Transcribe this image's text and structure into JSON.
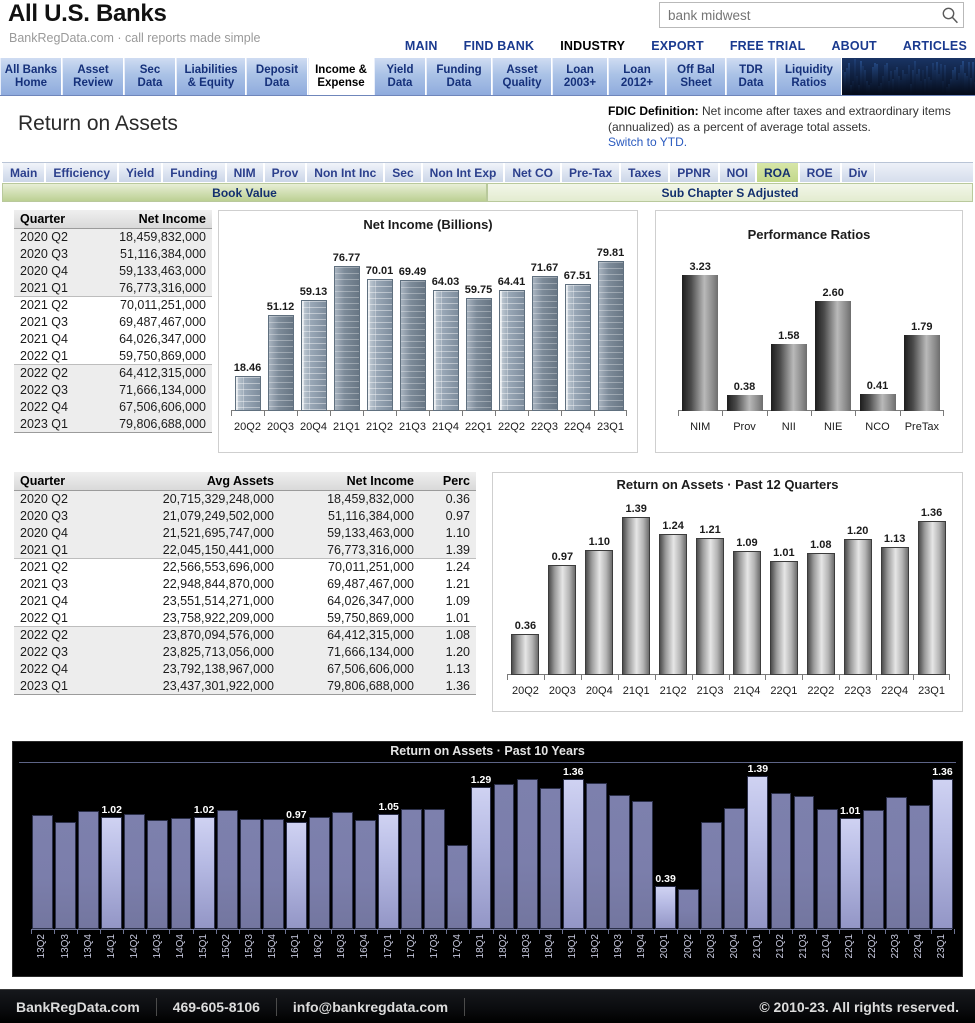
{
  "header": {
    "title": "All U.S. Banks",
    "subtitle": "BankRegData.com · call reports made simple",
    "search": {
      "value": "bank midwest",
      "placeholder": "bank midwest",
      "icon": "search-icon"
    },
    "nav": [
      "MAIN",
      "FIND BANK",
      "INDUSTRY",
      "EXPORT",
      "FREE TRIAL",
      "ABOUT",
      "ARTICLES"
    ],
    "nav_active": "INDUSTRY"
  },
  "tabs": {
    "items": [
      {
        "l1": "All Banks",
        "l2": "Home"
      },
      {
        "l1": "Asset",
        "l2": "Review"
      },
      {
        "l1": "Sec",
        "l2": "Data"
      },
      {
        "l1": "Liabilities",
        "l2": "& Equity"
      },
      {
        "l1": "Deposit",
        "l2": "Data"
      },
      {
        "l1": "Income &",
        "l2": "Expense"
      },
      {
        "l1": "Yield",
        "l2": "Data"
      },
      {
        "l1": "Funding",
        "l2": "Data"
      },
      {
        "l1": "Asset",
        "l2": "Quality"
      },
      {
        "l1": "Loan",
        "l2": "2003+"
      },
      {
        "l1": "Loan",
        "l2": "2012+"
      },
      {
        "l1": "Off Bal",
        "l2": "Sheet"
      },
      {
        "l1": "TDR",
        "l2": "Data"
      },
      {
        "l1": "Liquidity",
        "l2": "Ratios"
      }
    ],
    "active_index": 5
  },
  "page": {
    "title": "Return on Assets",
    "fdic_label": "FDIC Definition:",
    "fdic_text": " Net income after taxes and extraordinary items (annualized) as a percent of average total assets.",
    "fdic_link": "Switch to YTD."
  },
  "subtabs": {
    "items": [
      "Main",
      "Efficiency",
      "Yield",
      "Funding",
      "NIM",
      "Prov",
      "Non Int Inc",
      "Sec",
      "Non Int Exp",
      "Net CO",
      "Pre-Tax",
      "Taxes",
      "PPNR",
      "NOI",
      "ROA",
      "ROE",
      "Div"
    ],
    "active": "ROA"
  },
  "segments": {
    "book_value": "Book Value",
    "sub_chapter": "Sub Chapter S Adjusted"
  },
  "net_income_table": {
    "columns": [
      "Quarter",
      "Net Income"
    ],
    "rows": [
      [
        "2020 Q2",
        "18,459,832,000"
      ],
      [
        "2020 Q3",
        "51,116,384,000"
      ],
      [
        "2020 Q4",
        "59,133,463,000"
      ],
      [
        "2021 Q1",
        "76,773,316,000"
      ],
      [
        "2021 Q2",
        "70,011,251,000"
      ],
      [
        "2021 Q3",
        "69,487,467,000"
      ],
      [
        "2021 Q4",
        "64,026,347,000"
      ],
      [
        "2022 Q1",
        "59,750,869,000"
      ],
      [
        "2022 Q2",
        "64,412,315,000"
      ],
      [
        "2022 Q3",
        "71,666,134,000"
      ],
      [
        "2022 Q4",
        "67,506,606,000"
      ],
      [
        "2023 Q1",
        "79,806,688,000"
      ]
    ]
  },
  "roa_table": {
    "columns": [
      "Quarter",
      "Avg Assets",
      "Net Income",
      "Perc"
    ],
    "rows": [
      [
        "2020 Q2",
        "20,715,329,248,000",
        "18,459,832,000",
        "0.36"
      ],
      [
        "2020 Q3",
        "21,079,249,502,000",
        "51,116,384,000",
        "0.97"
      ],
      [
        "2020 Q4",
        "21,521,695,747,000",
        "59,133,463,000",
        "1.10"
      ],
      [
        "2021 Q1",
        "22,045,150,441,000",
        "76,773,316,000",
        "1.39"
      ],
      [
        "2021 Q2",
        "22,566,553,696,000",
        "70,011,251,000",
        "1.24"
      ],
      [
        "2021 Q3",
        "22,948,844,870,000",
        "69,487,467,000",
        "1.21"
      ],
      [
        "2021 Q4",
        "23,551,514,271,000",
        "64,026,347,000",
        "1.09"
      ],
      [
        "2022 Q1",
        "23,758,922,209,000",
        "59,750,869,000",
        "1.01"
      ],
      [
        "2022 Q2",
        "23,870,094,576,000",
        "64,412,315,000",
        "1.08"
      ],
      [
        "2022 Q3",
        "23,825,713,056,000",
        "71,666,134,000",
        "1.20"
      ],
      [
        "2022 Q4",
        "23,792,138,967,000",
        "67,506,606,000",
        "1.13"
      ],
      [
        "2023 Q1",
        "23,437,301,922,000",
        "79,806,688,000",
        "1.36"
      ]
    ]
  },
  "chart_data": [
    {
      "id": "net_income_billions",
      "type": "bar",
      "title": "Net Income (Billions)",
      "xlabel": "",
      "ylabel": "",
      "ylim": [
        0,
        86
      ],
      "grid": false,
      "categories": [
        "20Q2",
        "20Q3",
        "20Q4",
        "21Q1",
        "21Q2",
        "21Q3",
        "21Q4",
        "22Q1",
        "22Q2",
        "22Q3",
        "22Q4",
        "23Q1"
      ],
      "values": [
        18.46,
        51.12,
        59.13,
        76.77,
        70.01,
        69.49,
        64.03,
        59.75,
        64.41,
        71.67,
        67.51,
        79.81
      ],
      "labels": [
        "18.46",
        "51.12",
        "59.13",
        "76.77",
        "70.01",
        "69.49",
        "64.03",
        "59.75",
        "64.41",
        "71.67",
        "67.51",
        "79.81"
      ]
    },
    {
      "id": "performance_ratios",
      "type": "bar",
      "title": "Performance Ratios",
      "xlabel": "",
      "ylabel": "",
      "ylim": [
        0,
        3.6
      ],
      "grid": false,
      "categories": [
        "NIM",
        "Prov",
        "NII",
        "NIE",
        "NCO",
        "PreTax"
      ],
      "values": [
        3.23,
        0.38,
        1.58,
        2.6,
        0.41,
        1.79
      ],
      "labels": [
        "3.23",
        "0.38",
        "1.58",
        "2.60",
        "0.41",
        "1.79"
      ]
    },
    {
      "id": "roa_past_12_quarters",
      "type": "bar",
      "title": "Return on Assets · Past 12 Quarters",
      "xlabel": "",
      "ylabel": "",
      "ylim": [
        0,
        1.5
      ],
      "grid": false,
      "categories": [
        "20Q2",
        "20Q3",
        "20Q4",
        "21Q1",
        "21Q2",
        "21Q3",
        "21Q4",
        "22Q1",
        "22Q2",
        "22Q3",
        "22Q4",
        "23Q1"
      ],
      "values": [
        0.36,
        0.97,
        1.1,
        1.39,
        1.24,
        1.21,
        1.09,
        1.01,
        1.08,
        1.2,
        1.13,
        1.36
      ],
      "labels": [
        "0.36",
        "0.97",
        "1.10",
        "1.39",
        "1.24",
        "1.21",
        "1.09",
        "1.01",
        "1.08",
        "1.20",
        "1.13",
        "1.36"
      ]
    },
    {
      "id": "roa_past_10_years",
      "type": "bar",
      "title": "Return on Assets · Past 10 Years",
      "xlabel": "",
      "ylabel": "",
      "ylim": [
        0,
        1.5
      ],
      "grid": false,
      "categories": [
        "13Q2",
        "13Q3",
        "13Q4",
        "14Q1",
        "14Q2",
        "14Q3",
        "14Q4",
        "15Q1",
        "15Q2",
        "15Q3",
        "15Q4",
        "16Q1",
        "16Q2",
        "16Q3",
        "16Q4",
        "17Q1",
        "17Q2",
        "17Q3",
        "17Q4",
        "18Q1",
        "18Q2",
        "18Q3",
        "18Q4",
        "19Q1",
        "19Q2",
        "19Q3",
        "19Q4",
        "20Q1",
        "20Q2",
        "20Q3",
        "20Q4",
        "21Q1",
        "21Q2",
        "21Q3",
        "21Q4",
        "22Q1",
        "22Q2",
        "22Q3",
        "22Q4",
        "23Q1"
      ],
      "values": [
        1.04,
        0.97,
        1.07,
        1.02,
        1.05,
        0.99,
        1.01,
        1.02,
        1.08,
        1.0,
        1.0,
        0.97,
        1.02,
        1.06,
        0.99,
        1.05,
        1.09,
        1.09,
        0.76,
        1.29,
        1.32,
        1.36,
        1.28,
        1.36,
        1.33,
        1.22,
        1.16,
        0.39,
        0.36,
        0.97,
        1.1,
        1.39,
        1.24,
        1.21,
        1.09,
        1.01,
        1.08,
        1.2,
        1.13,
        1.36
      ],
      "highlight_indices": [
        3,
        7,
        11,
        15,
        19,
        23,
        27,
        31,
        35,
        39
      ],
      "point_labels": {
        "3": "1.02",
        "7": "1.02",
        "11": "0.97",
        "15": "1.05",
        "19": "1.29",
        "23": "1.36",
        "27": "0.39",
        "31": "1.39",
        "35": "1.01",
        "39": "1.36"
      }
    }
  ],
  "footer": {
    "site": "BankRegData.com",
    "phone": "469-605-8106",
    "email": "info@bankregdata.com",
    "copyright": "© 2010-23. All rights reserved."
  }
}
